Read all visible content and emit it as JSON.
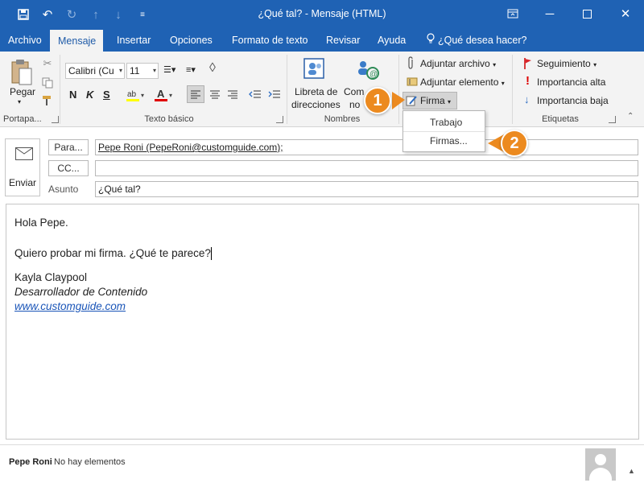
{
  "window": {
    "title": "¿Qué tal?  -  Mensaje (HTML)"
  },
  "tabs": [
    {
      "label": "Archivo"
    },
    {
      "label": "Mensaje"
    },
    {
      "label": "Insertar"
    },
    {
      "label": "Opciones"
    },
    {
      "label": "Formato de texto"
    },
    {
      "label": "Revisar"
    },
    {
      "label": "Ayuda"
    },
    {
      "label": "¿Qué desea hacer?"
    }
  ],
  "ribbon": {
    "clipboard": {
      "paste_label": "Pegar",
      "group_label": "Portapa..."
    },
    "basic_text": {
      "font_name": "Calibri (Cu",
      "font_size": "11",
      "bold": "N",
      "italic": "K",
      "underline": "S",
      "group_label": "Texto básico"
    },
    "names": {
      "address_book_line1": "Libreta de",
      "address_book_line2": "direcciones",
      "check_names_line1": "Com",
      "check_names_line2": "no",
      "group_label": "Nombres"
    },
    "include": {
      "attach_file": "Adjuntar archivo",
      "attach_item": "Adjuntar elemento",
      "signature": "Firma"
    },
    "tags": {
      "follow_up": "Seguimiento",
      "high_importance": "Importancia alta",
      "low_importance": "Importancia baja",
      "group_label": "Etiquetas"
    }
  },
  "dropdown": {
    "items": [
      {
        "label": "Trabajo"
      },
      {
        "label": "Firmas..."
      }
    ]
  },
  "callouts": [
    "1",
    "2"
  ],
  "compose": {
    "send_label": "Enviar",
    "to_label": "Para...",
    "to_value": "Pepe Roni (PepeRoni@customguide.com);",
    "cc_label": "CC...",
    "cc_value": "",
    "subject_label": "Asunto",
    "subject_value": "¿Qué tal?"
  },
  "message_body": {
    "greeting": "Hola Pepe.",
    "line": "Quiero probar mi firma. ¿Qué te parece?",
    "sig_name": "Kayla Claypool",
    "sig_title": "Desarrollador de Contenido",
    "sig_url": "www.customguide.com"
  },
  "footer": {
    "contact_name": "Pepe Roni",
    "status": "No hay elementos"
  },
  "colors": {
    "accent": "#1f62b4",
    "callout": "#ec8a1f",
    "link": "#1a55b8"
  }
}
